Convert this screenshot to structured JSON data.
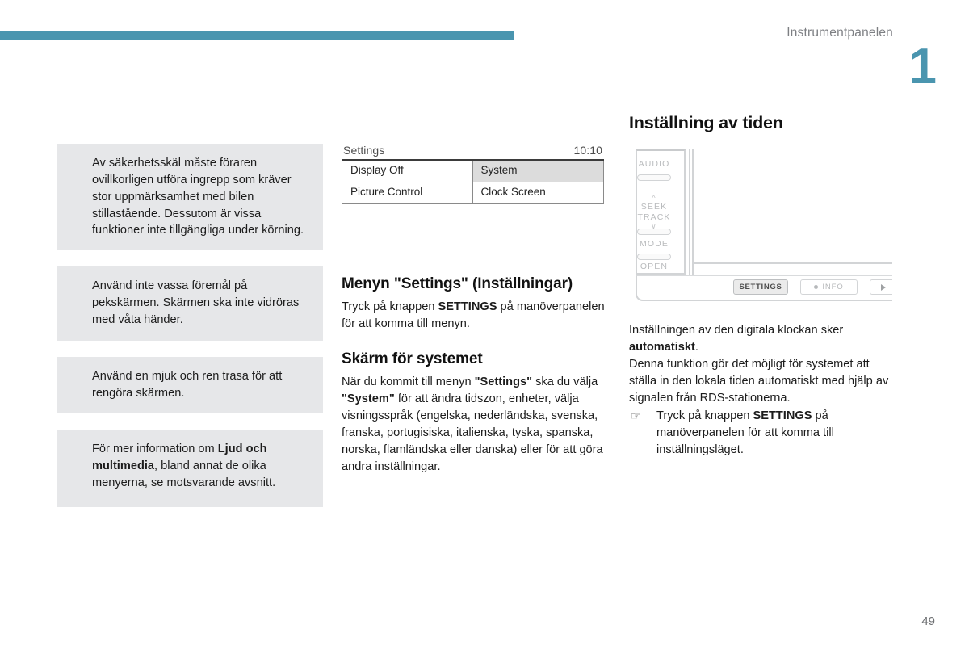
{
  "header": {
    "title": "Instrumentpanelen",
    "chapter": "1",
    "bar_color": "#4a95af"
  },
  "footer": {
    "page_number": "49"
  },
  "notices": [
    {
      "type": "warning",
      "icon": "warning-icon",
      "color": "#e8112d",
      "text": "Av säkerhetsskäl måste föraren ovillkorligen utföra ingrepp som kräver stor uppmärksamhet med bilen stillastående. Dessutom är vissa funktioner inte tillgängliga under körning."
    },
    {
      "type": "warning",
      "icon": "warning-icon",
      "color": "#e8112d",
      "text": "Använd inte vassa föremål på pekskärmen. Skärmen ska inte vidröras med våta händer."
    },
    {
      "type": "info",
      "icon": "info-icon",
      "color": "#1a9ad7",
      "text": "Använd en mjuk och ren trasa för att rengöra skärmen."
    },
    {
      "type": "info",
      "icon": "info-icon",
      "color": "#1a9ad7",
      "text_before": "För mer information om ",
      "text_bold": "Ljud och multimedia",
      "text_after": ", bland annat de olika menyerna, se motsvarande avsnitt."
    }
  ],
  "settings_screen": {
    "title": "Settings",
    "time": "10:10",
    "rows": [
      {
        "left": "Display Off",
        "right": "System",
        "right_selected": true
      },
      {
        "left": "Picture Control",
        "right": "Clock Screen",
        "right_selected": false
      }
    ]
  },
  "middle": {
    "section1": {
      "heading": "Menyn \"Settings\" (Inställningar)",
      "body_before": "Tryck på knappen ",
      "body_bold": "SETTINGS",
      "body_after": " på manöverpanelen för att komma till menyn."
    },
    "section2": {
      "heading": "Skärm för systemet",
      "p1_a": "När du kommit till menyn ",
      "p1_b": "\"Settings\"",
      "p1_c": " ska du välja ",
      "p1_d": "\"System\"",
      "p1_e": " för att ändra tidszon, enheter, välja visningsspråk (engelska, nederländska, svenska, franska, portugisiska, italienska, tyska, spanska, norska, flamländska eller danska) eller för att göra andra inställningar."
    }
  },
  "right": {
    "heading": "Inställning av tiden",
    "illustration": {
      "name": "audio-control-panel-illustration",
      "buttons": [
        "AUDIO",
        "SEEK\nTRACK",
        "MODE",
        "OPEN"
      ],
      "seek_label_line1": "SEEK",
      "seek_label_line2": "TRACK",
      "audio_label": "AUDIO",
      "mode_label": "MODE",
      "open_label": "OPEN",
      "hw_settings": "SETTINGS",
      "hw_info": "INFO"
    },
    "p1_a": "Inställningen av den digitala klockan sker ",
    "p1_bold": "automatiskt",
    "p1_b": ".",
    "p2": "Denna funktion gör det möjligt för systemet att ställa in den lokala tiden automatiskt med hjälp av signalen från RDS-stationerna.",
    "action_a": "Tryck på knappen ",
    "action_bold": "SETTINGS",
    "action_b": " på manöverpanelen för att komma till inställningsläget."
  }
}
